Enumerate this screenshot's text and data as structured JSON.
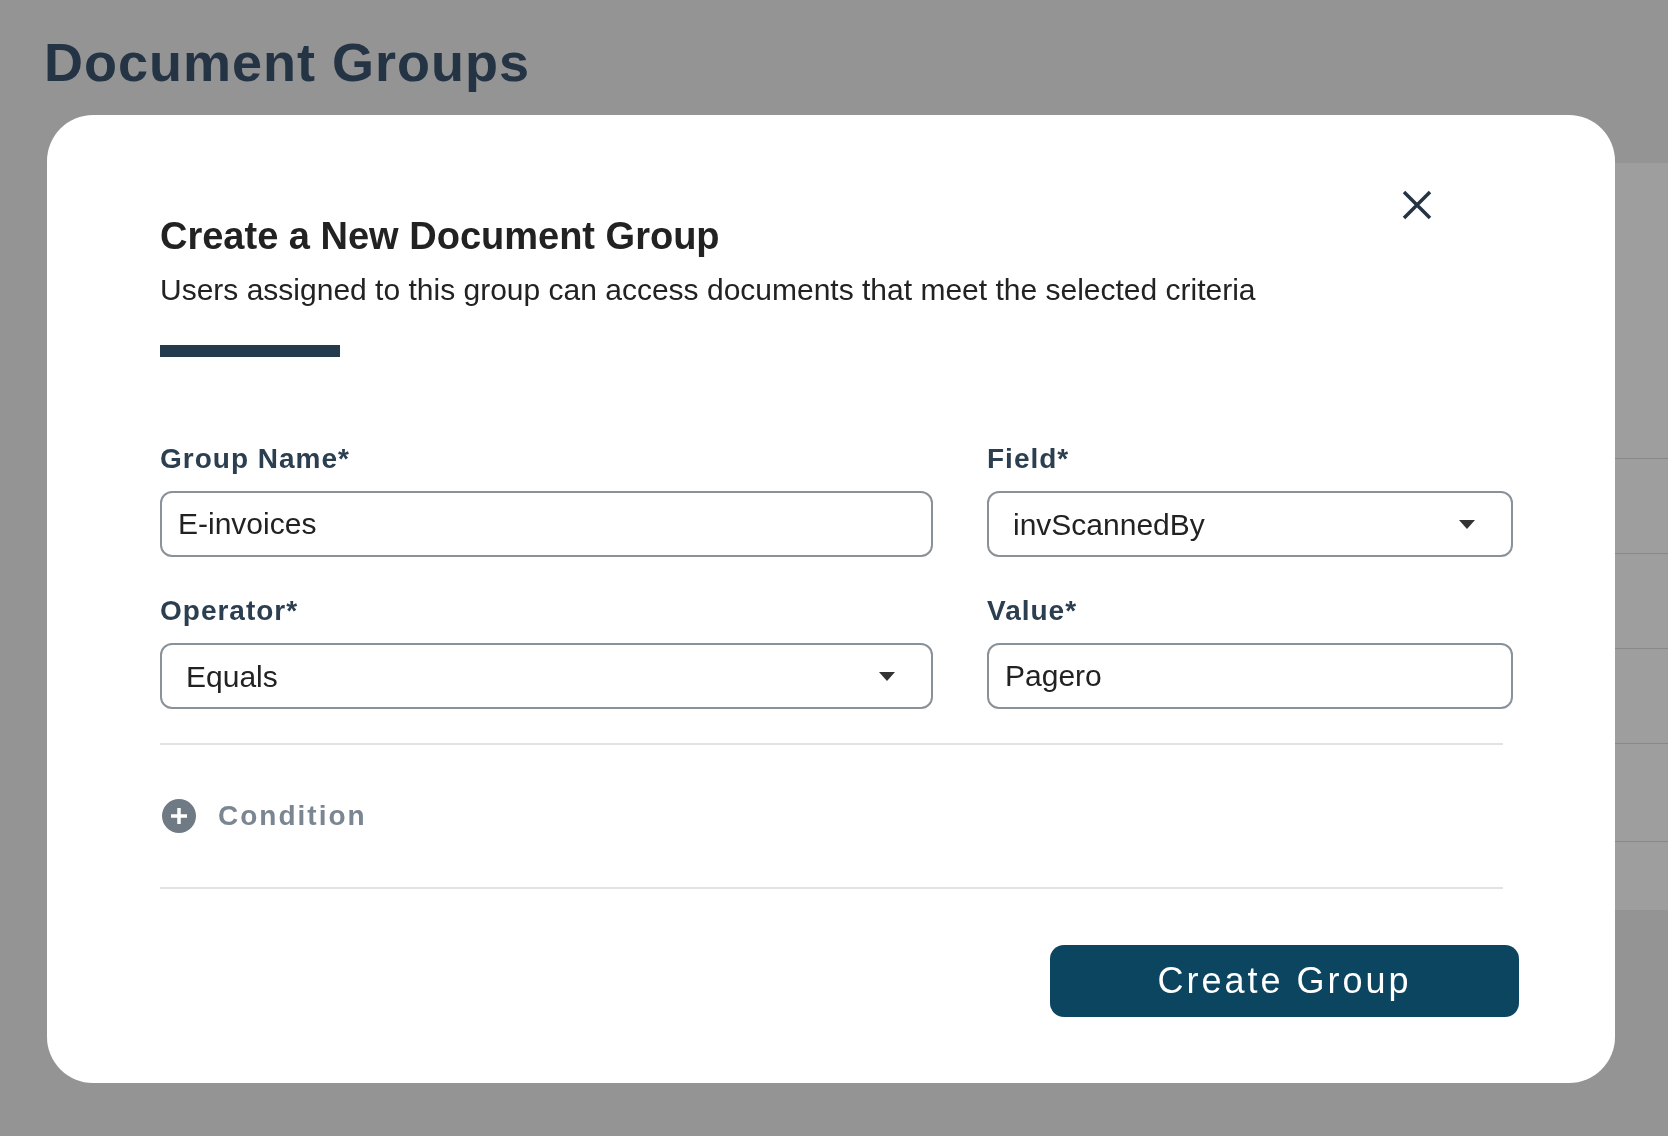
{
  "page": {
    "title": "Document Groups"
  },
  "dialog": {
    "title": "Create a New Document Group",
    "subtitle": "Users assigned to this group can access documents that meet the selected criteria",
    "fields": [
      {
        "label": "Group Name*",
        "kind": "input",
        "value": "E-invoices"
      },
      {
        "label": "Field*",
        "kind": "select",
        "value": "invScannedBy"
      },
      {
        "label": "Operator*",
        "kind": "select",
        "value": "Equals"
      },
      {
        "label": "Value*",
        "kind": "input",
        "value": "Pagero"
      }
    ],
    "add_condition": "Condition",
    "submit": "Create Group"
  }
}
